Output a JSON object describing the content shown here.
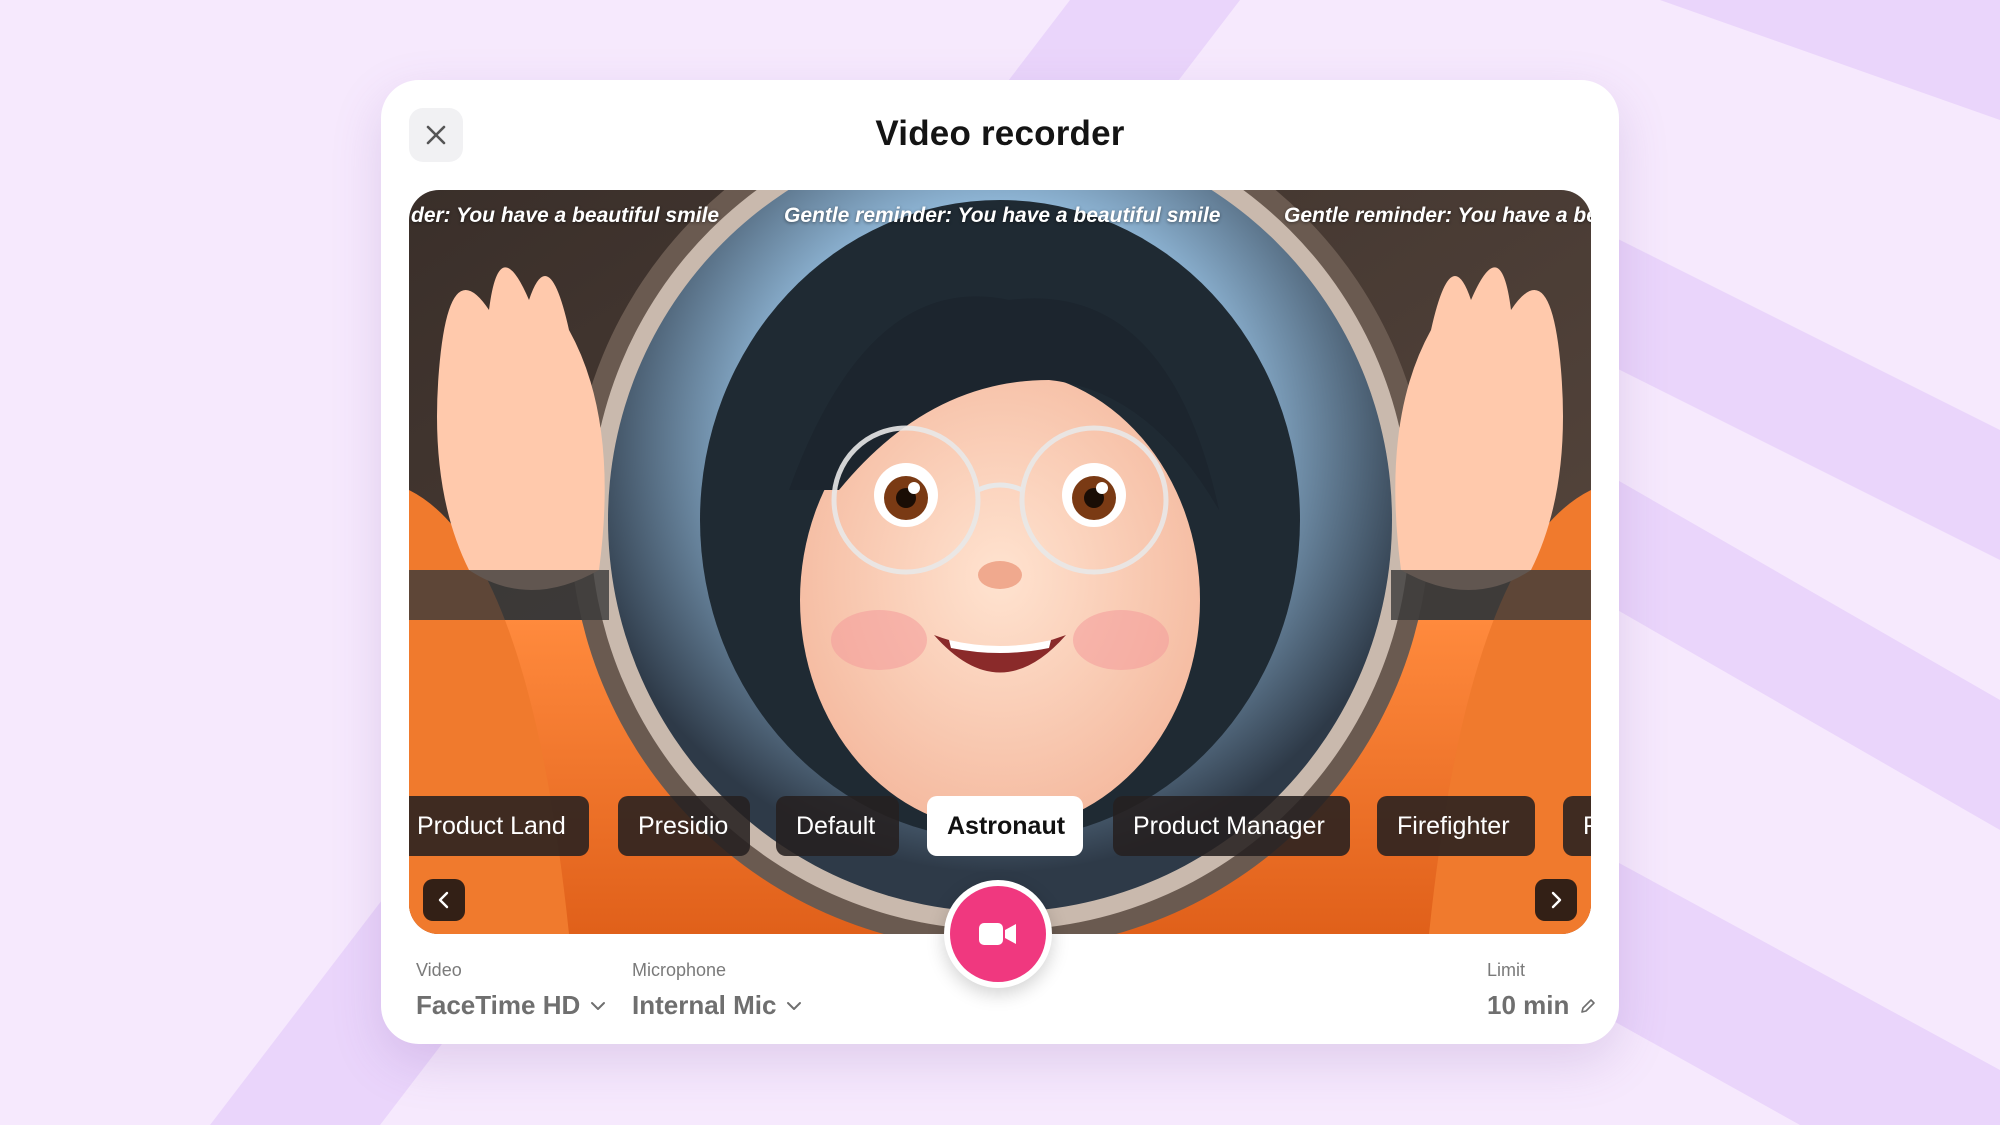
{
  "modal": {
    "title": "Video recorder"
  },
  "preview": {
    "marquee": [
      "der: You have a beautiful smile",
      "Gentle reminder: You have a beautiful smile",
      "Gentle reminder: You have a be"
    ]
  },
  "themes": {
    "items": [
      {
        "label": "Product Land",
        "active": false
      },
      {
        "label": "Presidio",
        "active": false
      },
      {
        "label": "Default",
        "active": false
      },
      {
        "label": "Astronaut",
        "active": true
      },
      {
        "label": "Product Manager",
        "active": false
      },
      {
        "label": "Firefighter",
        "active": false
      },
      {
        "label": "F",
        "active": false
      }
    ]
  },
  "controls": {
    "video_label": "Video",
    "video_value": "FaceTime HD",
    "mic_label": "Microphone",
    "mic_value": "Internal Mic",
    "limit_label": "Limit",
    "limit_value": "10 min"
  },
  "colors": {
    "record": "#f0387f",
    "background": "#f6e9fd",
    "stripe": "#ead5fb"
  },
  "icons": {
    "close": "close-icon",
    "prev": "chevron-left-icon",
    "next": "chevron-right-icon",
    "record": "video-camera-icon",
    "dropdown": "chevron-down-icon",
    "edit": "pencil-icon"
  }
}
